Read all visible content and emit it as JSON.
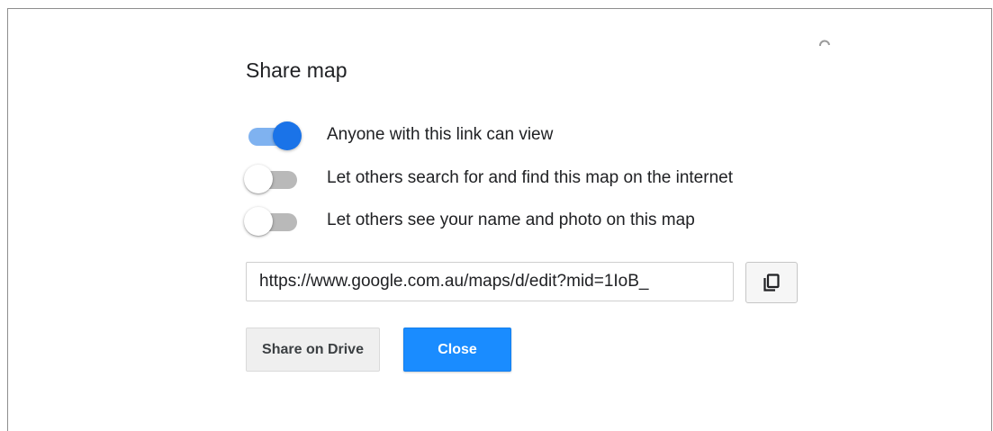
{
  "dialog": {
    "title": "Share map"
  },
  "toggles": [
    {
      "label": "Anyone with this link can view",
      "on": true
    },
    {
      "label": "Let others search for and find this map on the internet",
      "on": false
    },
    {
      "label": "Let others see your name and photo on this map",
      "on": false
    }
  ],
  "link": {
    "value": "https://www.google.com.au/maps/d/edit?mid=1IoB_"
  },
  "buttons": {
    "share_drive_label": "Share on Drive",
    "close_label": "Close"
  },
  "icons": {
    "copy": "copy-icon"
  },
  "colors": {
    "accent": "#1a73e8",
    "close_button": "#1a8cff",
    "toggle_track_on": "#7fb2f0",
    "toggle_track_off": "#b9b9b9"
  }
}
